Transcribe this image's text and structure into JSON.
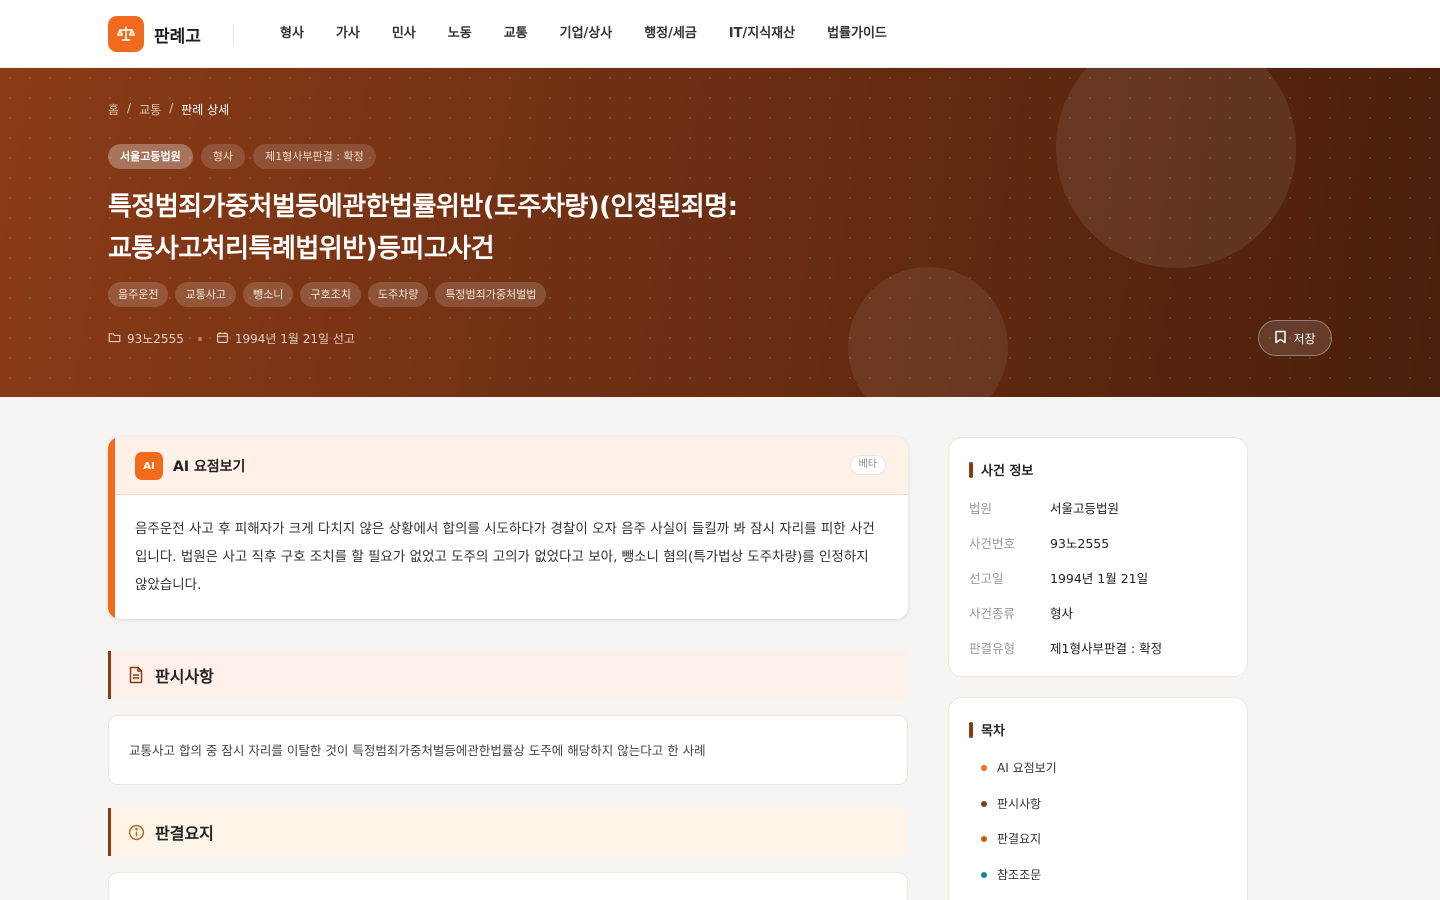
{
  "app": {
    "logo_text": "판례고"
  },
  "nav": [
    "형사",
    "가사",
    "민사",
    "노동",
    "교통",
    "기업/상사",
    "행정/세금",
    "IT/지식재산",
    "법률가이드"
  ],
  "breadcrumb": {
    "home": "홈",
    "category": "교통",
    "current": "판례 상세",
    "separator": "/"
  },
  "case": {
    "court": "서울고등법원",
    "type": "형사",
    "verdict": "제1형사부판결 : 확정",
    "title_line1": "특정범죄가중처벌등에관한법률위반(도주차량)(인정된죄명:",
    "title_line2": "교통사고처리특례법위반)등피고사건",
    "tags": [
      "음주운전",
      "교통사고",
      "뺑소니",
      "구호조치",
      "도주차량",
      "특정범죄가중처벌법"
    ],
    "number": "93노2555",
    "date_text": "1994년 1월 21일 선고",
    "save_label": "저장"
  },
  "ai_summary": {
    "badge": "AI",
    "title": "AI 요점보기",
    "beta": "베타",
    "text": "음주운전 사고 후 피해자가 크게 다치지 않은 상황에서 합의를 시도하다가 경찰이 오자 음주 사실이 들킬까 봐 잠시 자리를 피한 사건입니다. 법원은 사고 직후 구호 조치를 할 필요가 없었고 도주의 고의가 없었다고 보아, 뺑소니 혐의(특가법상 도주차량)를 인정하지 않았습니다."
  },
  "sections": {
    "holding_title": "판시사항",
    "holding_text": "교통사고 합의 중 잠시 자리를 이탈한 것이 특정범죄가중처벌등에관한법률상 도주에 해당하지 않는다고 한 사례",
    "summary_title": "판결요지"
  },
  "case_info": {
    "title": "사건 정보",
    "rows": [
      {
        "k": "법원",
        "v": "서울고등법원"
      },
      {
        "k": "사건번호",
        "v": "93노2555"
      },
      {
        "k": "선고일",
        "v": "1994년 1월 21일"
      },
      {
        "k": "사건종류",
        "v": "형사"
      },
      {
        "k": "판결유형",
        "v": "제1형사부판결 : 확정"
      }
    ]
  },
  "toc": {
    "title": "목차",
    "items": [
      "AI 요점보기",
      "판시사항",
      "판결요지",
      "참조조문"
    ]
  },
  "colors": {
    "accent": "#f26a1b",
    "brand_brown": "#8a3b16",
    "teal": "#0f8a8a"
  }
}
